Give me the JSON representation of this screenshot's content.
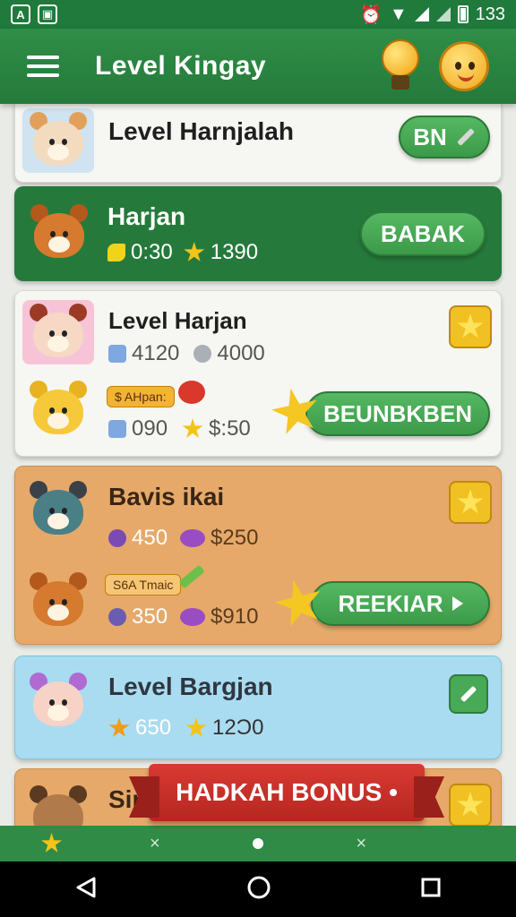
{
  "status_bar": {
    "time": "133"
  },
  "app_bar": {
    "title": "Level Kingay"
  },
  "cards": [
    {
      "title": "Level Harnjalah",
      "button": "BN"
    },
    {
      "title": "Harjan",
      "time": "0:30",
      "stars": "1390",
      "button": "BABAK"
    },
    {
      "title": "Level Harjan",
      "stat_a": "4120",
      "stat_b": "4000",
      "tag": "$ AHpan:",
      "stat_c": "090",
      "stat_d": "$:50",
      "button": "BEUNBKBEN"
    },
    {
      "title": "Bavis ikai",
      "stat_a": "450",
      "stat_b": "$250",
      "tag": "S6A Tmaic",
      "stat_c": "350",
      "stat_d": "$910",
      "button": "REEKIAR"
    },
    {
      "title": "Level Bargjan",
      "stat_a": "650",
      "stat_b": "12Ɔ0"
    },
    {
      "title": "Sino"
    }
  ],
  "banner": {
    "label": "HADKAH BONUS •"
  },
  "bottom_tabs": [
    "×",
    "×"
  ],
  "colors": {
    "app_green": "#257a3b",
    "button_green": "#3b9a49",
    "ribbon_red": "#c62e27",
    "card_orange": "#e6a96a",
    "card_blue": "#a9dcf1"
  }
}
